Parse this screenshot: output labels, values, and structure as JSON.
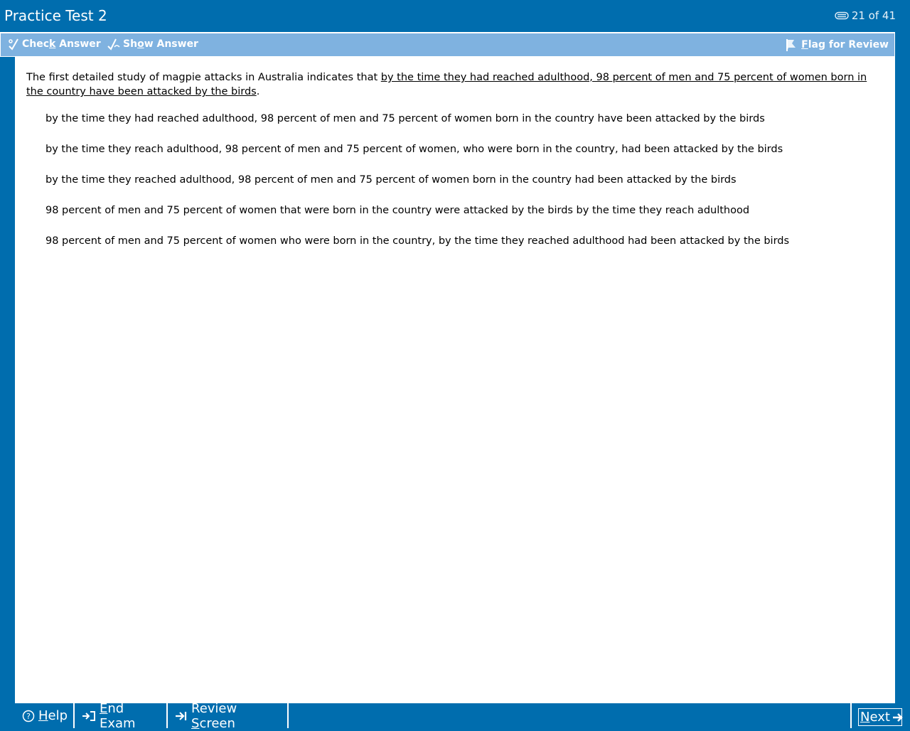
{
  "header": {
    "title": "Practice Test 2",
    "progress": "21 of 41",
    "progress_icon": "paperclip-icon"
  },
  "toolbar": {
    "check_answer": {
      "pre": "Chec",
      "key": "k",
      "post": " Answer"
    },
    "show_answer": {
      "pre": "Sh",
      "key": "o",
      "post": "w Answer"
    },
    "flag_review": {
      "pre": "",
      "key": "F",
      "post": "lag for Review"
    }
  },
  "question": {
    "prefix": "The first detailed study of magpie attacks in Australia indicates that ",
    "underlined": "by the time they had reached adulthood, 98 percent of men and 75 percent of women born in the country have been attacked by the birds",
    "suffix": "."
  },
  "options": [
    "by the time they had reached adulthood, 98 percent of men and 75 percent of women born in the country have been attacked by the birds",
    "by the time they reach adulthood, 98 percent of men and 75 percent of women, who were born in the country, had been attacked by the birds",
    "by the time they reached adulthood, 98 percent of men and 75 percent of women born in the country had been attacked by the birds",
    "98 percent of men and 75 percent of women that were born in the country were attacked by the birds by the time they reach adulthood",
    "98 percent of men and 75 percent of women who were born in the country, by the time they reached adulthood had been attacked by the birds"
  ],
  "footer": {
    "help": {
      "key": "H",
      "post": "elp"
    },
    "end_exam": {
      "key": "E",
      "post": "nd Exam"
    },
    "review_screen": {
      "pre": "Review ",
      "key": "S",
      "post": "creen"
    },
    "next": {
      "key": "N",
      "post": "ext"
    }
  },
  "colors": {
    "frame": "#006dae",
    "toolbar": "#7fb2e0",
    "content": "#ffffff"
  }
}
